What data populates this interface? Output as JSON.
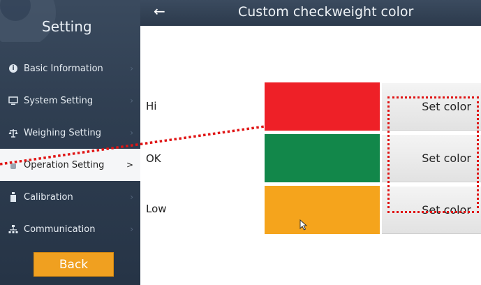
{
  "sidebar": {
    "title": "Setting",
    "items": [
      {
        "label": "Basic Information",
        "icon": "info-icon"
      },
      {
        "label": "System Setting",
        "icon": "monitor-icon"
      },
      {
        "label": "Weighing Setting",
        "icon": "scale-icon"
      },
      {
        "label": "Operation Setting",
        "icon": "hand-icon"
      },
      {
        "label": "Calibration",
        "icon": "weight-icon"
      },
      {
        "label": "Communication",
        "icon": "network-icon"
      }
    ],
    "active_chevron": ">",
    "back_label": "Back"
  },
  "header": {
    "back_arrow": "←",
    "title": "Custom checkweight color"
  },
  "rows": [
    {
      "label": "Hi",
      "color": "#ee2027",
      "button": "Set color"
    },
    {
      "label": "OK",
      "color": "#12874a",
      "button": "Set color"
    },
    {
      "label": "Low",
      "color": "#f5a41c",
      "button": "Set color"
    }
  ],
  "colors": {
    "annotation": "#e01515",
    "back_button": "#f0a020"
  }
}
